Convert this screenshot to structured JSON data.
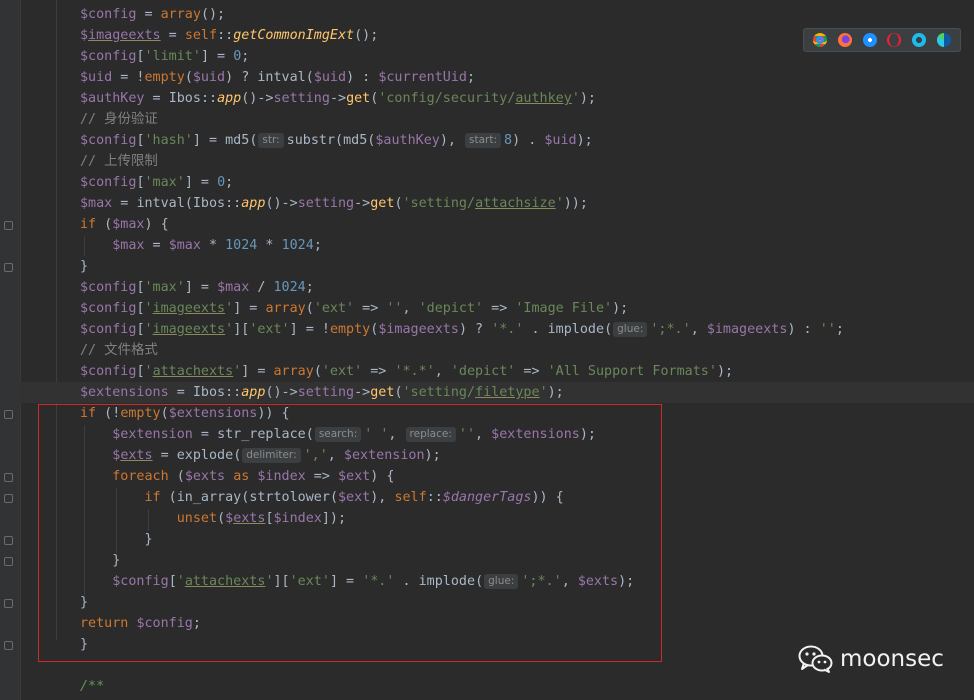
{
  "editor": {
    "lines": [
      [
        [
          "$config",
          "v"
        ],
        [
          " = ",
          ""
        ],
        [
          "array",
          "k"
        ],
        [
          "();",
          ""
        ]
      ],
      [
        [
          "$",
          "v"
        ],
        [
          "imageexts",
          "v u"
        ],
        [
          " = ",
          ""
        ],
        [
          "self",
          "k"
        ],
        [
          "::",
          ""
        ],
        [
          "getCommonImgExt",
          "fi"
        ],
        [
          "();",
          ""
        ]
      ],
      [
        [
          "$config",
          "v"
        ],
        [
          "[",
          ""
        ],
        [
          "'limit'",
          "s"
        ],
        [
          "] = ",
          ""
        ],
        [
          "0",
          "n"
        ],
        [
          ";",
          ""
        ]
      ],
      [
        [
          "$uid",
          "v"
        ],
        [
          " = !",
          ""
        ],
        [
          "empty",
          "k"
        ],
        [
          "(",
          ""
        ],
        [
          "$uid",
          "v"
        ],
        [
          ") ? ",
          ""
        ],
        [
          "intval",
          "cls"
        ],
        [
          "(",
          ""
        ],
        [
          "$uid",
          "v"
        ],
        [
          ") : ",
          ""
        ],
        [
          "$currentUid",
          "v"
        ],
        [
          ";",
          ""
        ]
      ],
      [
        [
          "$authKey",
          "v"
        ],
        [
          " = ",
          ""
        ],
        [
          "Ibos",
          "cls"
        ],
        [
          "::",
          ""
        ],
        [
          "app",
          "fi"
        ],
        [
          "()->",
          ""
        ],
        [
          "setting",
          "v"
        ],
        [
          "->",
          ""
        ],
        [
          "get",
          "fn"
        ],
        [
          "(",
          ""
        ],
        [
          "'config/security/",
          "s"
        ],
        [
          "authkey",
          "s u"
        ],
        [
          "'",
          "s"
        ],
        [
          ");",
          ""
        ]
      ],
      [
        [
          "// 身份验证",
          "c"
        ]
      ],
      [
        [
          "$config",
          "v"
        ],
        [
          "[",
          ""
        ],
        [
          "'hash'",
          "s"
        ],
        [
          "] = ",
          ""
        ],
        [
          "md5",
          "cls"
        ],
        [
          "(",
          ""
        ],
        [
          "str:",
          "hint"
        ],
        [
          "substr",
          "cls"
        ],
        [
          "(",
          ""
        ],
        [
          "md5",
          "cls"
        ],
        [
          "(",
          ""
        ],
        [
          "$authKey",
          "v"
        ],
        [
          "), ",
          ""
        ],
        [
          "start:",
          "hint"
        ],
        [
          "8",
          "n"
        ],
        [
          ") . ",
          ""
        ],
        [
          "$uid",
          "v"
        ],
        [
          ");",
          ""
        ]
      ],
      [
        [
          "// 上传限制",
          "c"
        ]
      ],
      [
        [
          "$config",
          "v"
        ],
        [
          "[",
          ""
        ],
        [
          "'max'",
          "s"
        ],
        [
          "] = ",
          ""
        ],
        [
          "0",
          "n"
        ],
        [
          ";",
          ""
        ]
      ],
      [
        [
          "$max",
          "v"
        ],
        [
          " = ",
          ""
        ],
        [
          "intval",
          "cls"
        ],
        [
          "(",
          ""
        ],
        [
          "Ibos",
          "cls"
        ],
        [
          "::",
          ""
        ],
        [
          "app",
          "fi"
        ],
        [
          "()->",
          ""
        ],
        [
          "setting",
          "v"
        ],
        [
          "->",
          ""
        ],
        [
          "get",
          "fn"
        ],
        [
          "(",
          ""
        ],
        [
          "'setting/",
          "s"
        ],
        [
          "attachsize",
          "s u"
        ],
        [
          "'",
          "s"
        ],
        [
          "));",
          ""
        ]
      ],
      [
        [
          "if",
          "k"
        ],
        [
          " (",
          ""
        ],
        [
          "$max",
          "v"
        ],
        [
          ") {",
          ""
        ]
      ],
      [
        [
          "    ",
          ""
        ],
        [
          "$max",
          "v"
        ],
        [
          " = ",
          ""
        ],
        [
          "$max",
          "v"
        ],
        [
          " * ",
          ""
        ],
        [
          "1024",
          "n"
        ],
        [
          " * ",
          ""
        ],
        [
          "1024",
          "n"
        ],
        [
          ";",
          ""
        ]
      ],
      [
        [
          "}",
          ""
        ]
      ],
      [
        [
          "$config",
          "v"
        ],
        [
          "[",
          ""
        ],
        [
          "'max'",
          "s"
        ],
        [
          "] = ",
          ""
        ],
        [
          "$max",
          "v"
        ],
        [
          " / ",
          ""
        ],
        [
          "1024",
          "n"
        ],
        [
          ";",
          ""
        ]
      ],
      [
        [
          "$config",
          "v"
        ],
        [
          "[",
          ""
        ],
        [
          "'",
          "s"
        ],
        [
          "imageexts",
          "s u"
        ],
        [
          "'",
          "s"
        ],
        [
          "] = ",
          ""
        ],
        [
          "array",
          "k"
        ],
        [
          "(",
          ""
        ],
        [
          "'ext'",
          "s"
        ],
        [
          " => ",
          ""
        ],
        [
          "''",
          "s"
        ],
        [
          ", ",
          ""
        ],
        [
          "'depict'",
          "s"
        ],
        [
          " => ",
          ""
        ],
        [
          "'Image File'",
          "s"
        ],
        [
          ");",
          ""
        ]
      ],
      [
        [
          "$config",
          "v"
        ],
        [
          "[",
          ""
        ],
        [
          "'",
          "s"
        ],
        [
          "imageexts",
          "s u"
        ],
        [
          "'",
          "s"
        ],
        [
          "][",
          ""
        ],
        [
          "'ext'",
          "s"
        ],
        [
          "] = !",
          ""
        ],
        [
          "empty",
          "k"
        ],
        [
          "(",
          ""
        ],
        [
          "$imageexts",
          "v"
        ],
        [
          ") ? ",
          ""
        ],
        [
          "'*.'",
          "s"
        ],
        [
          " . ",
          ""
        ],
        [
          "implode",
          "cls"
        ],
        [
          "(",
          ""
        ],
        [
          "glue:",
          "hint"
        ],
        [
          "';*.'",
          "s"
        ],
        [
          ", ",
          ""
        ],
        [
          "$imageexts",
          "v"
        ],
        [
          ") : ",
          ""
        ],
        [
          "''",
          "s"
        ],
        [
          ";",
          ""
        ]
      ],
      [
        [
          "// 文件格式",
          "c"
        ]
      ],
      [
        [
          "$config",
          "v"
        ],
        [
          "[",
          ""
        ],
        [
          "'",
          "s"
        ],
        [
          "attachexts",
          "s u"
        ],
        [
          "'",
          "s"
        ],
        [
          "] = ",
          ""
        ],
        [
          "array",
          "k"
        ],
        [
          "(",
          ""
        ],
        [
          "'ext'",
          "s"
        ],
        [
          " => ",
          ""
        ],
        [
          "'*.*'",
          "s"
        ],
        [
          ", ",
          ""
        ],
        [
          "'depict'",
          "s"
        ],
        [
          " => ",
          ""
        ],
        [
          "'All Support Formats'",
          "s"
        ],
        [
          ");",
          ""
        ]
      ],
      [
        [
          "$extensions",
          "v"
        ],
        [
          " = ",
          ""
        ],
        [
          "Ibos",
          "cls"
        ],
        [
          "::",
          ""
        ],
        [
          "app",
          "fi"
        ],
        [
          "()->",
          ""
        ],
        [
          "setting",
          "v"
        ],
        [
          "->",
          ""
        ],
        [
          "get",
          "fn"
        ],
        [
          "(",
          ""
        ],
        [
          "'setting/",
          "s"
        ],
        [
          "filetype",
          "s u"
        ],
        [
          "'",
          "s"
        ],
        [
          ");",
          ""
        ]
      ],
      [
        [
          "if",
          "k"
        ],
        [
          " (!",
          ""
        ],
        [
          "empty",
          "k"
        ],
        [
          "(",
          ""
        ],
        [
          "$extensions",
          "v"
        ],
        [
          ")) {",
          ""
        ]
      ],
      [
        [
          "    ",
          ""
        ],
        [
          "$extension",
          "v"
        ],
        [
          " = ",
          ""
        ],
        [
          "str_replace",
          "cls"
        ],
        [
          "(",
          ""
        ],
        [
          "search:",
          "hint"
        ],
        [
          "' '",
          "s"
        ],
        [
          ", ",
          ""
        ],
        [
          "replace:",
          "hint"
        ],
        [
          "''",
          "s"
        ],
        [
          ", ",
          ""
        ],
        [
          "$extensions",
          "v"
        ],
        [
          ");",
          ""
        ]
      ],
      [
        [
          "    ",
          ""
        ],
        [
          "$",
          "v"
        ],
        [
          "exts",
          "v u"
        ],
        [
          " = ",
          ""
        ],
        [
          "explode",
          "cls"
        ],
        [
          "(",
          ""
        ],
        [
          "delimiter:",
          "hint"
        ],
        [
          "','",
          "s"
        ],
        [
          ", ",
          ""
        ],
        [
          "$extension",
          "v"
        ],
        [
          ");",
          ""
        ]
      ],
      [
        [
          "    ",
          ""
        ],
        [
          "foreach",
          "k"
        ],
        [
          " (",
          ""
        ],
        [
          "$exts",
          "v"
        ],
        [
          " ",
          ""
        ],
        [
          "as",
          "k"
        ],
        [
          " ",
          ""
        ],
        [
          "$index",
          "v"
        ],
        [
          " => ",
          ""
        ],
        [
          "$ext",
          "v"
        ],
        [
          ") {",
          ""
        ]
      ],
      [
        [
          "        ",
          ""
        ],
        [
          "if",
          "k"
        ],
        [
          " (",
          ""
        ],
        [
          "in_array",
          "cls"
        ],
        [
          "(",
          ""
        ],
        [
          "strtolower",
          "cls"
        ],
        [
          "(",
          ""
        ],
        [
          "$ext",
          "v"
        ],
        [
          "), ",
          ""
        ],
        [
          "self",
          "k"
        ],
        [
          "::",
          ""
        ],
        [
          "$dangerTags",
          "st"
        ],
        [
          ")) {",
          ""
        ]
      ],
      [
        [
          "            ",
          ""
        ],
        [
          "unset",
          "k"
        ],
        [
          "(",
          ""
        ],
        [
          "$",
          "v"
        ],
        [
          "exts",
          "v u"
        ],
        [
          "[",
          ""
        ],
        [
          "$index",
          "v"
        ],
        [
          "]);",
          ""
        ]
      ],
      [
        [
          "        ",
          ""
        ],
        [
          "}",
          ""
        ]
      ],
      [
        [
          "    ",
          ""
        ],
        [
          "}",
          ""
        ]
      ],
      [
        [
          "    ",
          ""
        ],
        [
          "$config",
          "v"
        ],
        [
          "[",
          ""
        ],
        [
          "'",
          "s"
        ],
        [
          "attachexts",
          "s u"
        ],
        [
          "'",
          "s"
        ],
        [
          "][",
          ""
        ],
        [
          "'ext'",
          "s"
        ],
        [
          "] = ",
          ""
        ],
        [
          "'*.'",
          "s"
        ],
        [
          " . ",
          ""
        ],
        [
          "implode",
          "cls"
        ],
        [
          "(",
          ""
        ],
        [
          "glue:",
          "hint"
        ],
        [
          "';*.'",
          "s"
        ],
        [
          ", ",
          ""
        ],
        [
          "$exts",
          "v"
        ],
        [
          ");",
          ""
        ]
      ],
      [
        [
          "}",
          ""
        ]
      ],
      [
        [
          "return",
          "k"
        ],
        [
          " ",
          ""
        ],
        [
          "$config",
          "v"
        ],
        [
          ";",
          ""
        ]
      ],
      [
        [
          "}",
          ""
        ]
      ],
      [
        [
          "",
          ""
        ]
      ],
      [
        [
          "/**",
          "doc"
        ]
      ]
    ]
  },
  "watermark": {
    "text": "moonsec",
    "logo": "wechat-logo-icon"
  },
  "browser_icons": [
    "chrome-icon",
    "firefox-icon",
    "safari-icon",
    "opera-icon",
    "ie-icon",
    "edge-icon"
  ]
}
